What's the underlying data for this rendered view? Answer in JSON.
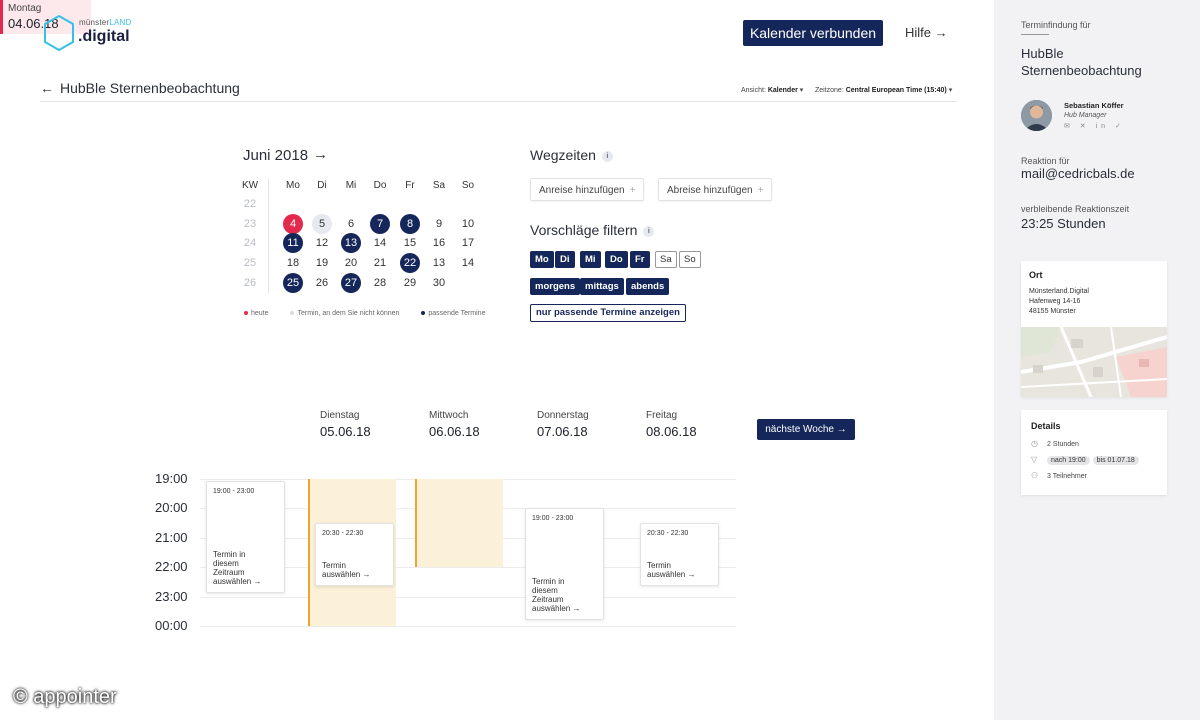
{
  "logo": {
    "line1_a": "münster",
    "line1_b": "LAND",
    "line2": ".digital"
  },
  "header": {
    "connect_label": "Kalender verbunden",
    "help_label": "Hilfe →"
  },
  "event": {
    "back_arrow": "←",
    "title": "HubBle Sternenbeobachtung",
    "view_label": "Ansicht:",
    "view_value": "Kalender",
    "tz_label": "Zeitzone:",
    "tz_value": "Central European Time (15:40)"
  },
  "calendar": {
    "month": "Juni 2018",
    "next_arrow": "→",
    "headers": [
      "KW",
      "Mo",
      "Di",
      "Mi",
      "Do",
      "Fr",
      "Sa",
      "So"
    ],
    "weeks": [
      {
        "kw": "22",
        "days": [
          {
            "d": "",
            "s": ""
          },
          {
            "d": "",
            "s": ""
          },
          {
            "d": "",
            "s": ""
          },
          {
            "d": "",
            "s": ""
          },
          {
            "d": "",
            "s": ""
          },
          {
            "d": "",
            "s": ""
          },
          {
            "d": "",
            "s": ""
          }
        ]
      },
      {
        "kw": "23",
        "days": [
          {
            "d": "4",
            "s": "today"
          },
          {
            "d": "5",
            "s": "busy"
          },
          {
            "d": "6",
            "s": ""
          },
          {
            "d": "7",
            "s": "match"
          },
          {
            "d": "8",
            "s": "match"
          },
          {
            "d": "9",
            "s": ""
          },
          {
            "d": "10",
            "s": ""
          }
        ]
      },
      {
        "kw": "24",
        "days": [
          {
            "d": "11",
            "s": "match"
          },
          {
            "d": "12",
            "s": ""
          },
          {
            "d": "13",
            "s": "match"
          },
          {
            "d": "14",
            "s": ""
          },
          {
            "d": "15",
            "s": ""
          },
          {
            "d": "16",
            "s": ""
          },
          {
            "d": "17",
            "s": ""
          }
        ]
      },
      {
        "kw": "25",
        "days": [
          {
            "d": "18",
            "s": ""
          },
          {
            "d": "19",
            "s": ""
          },
          {
            "d": "20",
            "s": ""
          },
          {
            "d": "21",
            "s": ""
          },
          {
            "d": "22",
            "s": "match"
          },
          {
            "d": "13",
            "s": ""
          },
          {
            "d": "14",
            "s": ""
          }
        ]
      },
      {
        "kw": "26",
        "days": [
          {
            "d": "25",
            "s": "match"
          },
          {
            "d": "26",
            "s": ""
          },
          {
            "d": "27",
            "s": "match"
          },
          {
            "d": "28",
            "s": ""
          },
          {
            "d": "29",
            "s": ""
          },
          {
            "d": "30",
            "s": ""
          },
          {
            "d": "",
            "s": ""
          }
        ]
      }
    ],
    "legend": {
      "today": "heute",
      "busy": "Termin, an dem Sie nicht können",
      "match": "passende Termine",
      "today_color": "#e4294f",
      "busy_color": "#d9dce3",
      "match_color": "#15275a"
    }
  },
  "filters": {
    "travel_title": "Wegzeiten",
    "info_glyph": "i",
    "arrival_label": "Anreise hinzufügen",
    "departure_label": "Abreise hinzufügen",
    "plus_glyph": "+",
    "suggest_title": "Vorschläge filtern",
    "weekdays": [
      {
        "label": "Mo",
        "active": true
      },
      {
        "label": "Di",
        "active": true
      },
      {
        "label": "Mi",
        "active": true
      },
      {
        "label": "Do",
        "active": true
      },
      {
        "label": "Fr",
        "active": true
      },
      {
        "label": "Sa",
        "active": false
      },
      {
        "label": "So",
        "active": false
      }
    ],
    "times": [
      "morgens",
      "mittags",
      "abends"
    ],
    "only_matching": "nur passende Termine anzeigen"
  },
  "week": {
    "days": [
      {
        "name": "Montag",
        "date": "04.06.18"
      },
      {
        "name": "Dienstag",
        "date": "05.06.18"
      },
      {
        "name": "Mittwoch",
        "date": "06.06.18"
      },
      {
        "name": "Donnerstag",
        "date": "07.06.18"
      },
      {
        "name": "Freitag",
        "date": "08.06.18"
      }
    ],
    "next_week": "nächste Woche →"
  },
  "timeline": {
    "hours": [
      "19:00",
      "20:00",
      "21:00",
      "22:00",
      "23:00",
      "00:00"
    ],
    "slots": [
      {
        "time": "19:00 - 23:00",
        "cta": "Termin in\ndiesem\nZeitraum\nauswählen →"
      },
      {
        "time": "20:30 - 22:30",
        "cta": "Termin\nauswählen →"
      },
      {
        "time": "19:00 - 23:00",
        "cta": "Termin in\ndiesem\nZeitraum\nauswählen →"
      },
      {
        "time": "20:30 - 22:30",
        "cta": "Termin\nauswählen →"
      }
    ],
    "selected_color": "#f0a52a"
  },
  "sidebar": {
    "for_label": "Terminfindung für",
    "title": "HubBle Sternenbeobachtung",
    "person_name": "Sebastian Köffer",
    "person_role": "Hub Manager",
    "socials": [
      "mail-icon",
      "xing-icon",
      "linkedin-icon",
      "twitter-icon"
    ],
    "socials_text": "✉ ✕ in ✓",
    "reaction_label": "Reaktion für",
    "email": "mail@cedricbals.de",
    "remaining_label": "verbleibende Reaktionszeit",
    "remaining_value": "23:25 Stunden",
    "location": {
      "head": "Ort",
      "line1": "Münsterland.Digital",
      "line2": "Hafenweg 14-16",
      "line3": "48155 Münster"
    },
    "details": {
      "head": "Details",
      "duration": "2 Stunden",
      "filter_after": "nach 19:00",
      "filter_until": "bis 01.07.18",
      "participants": "3 Teilnehmer"
    }
  },
  "watermark": "© appointer"
}
